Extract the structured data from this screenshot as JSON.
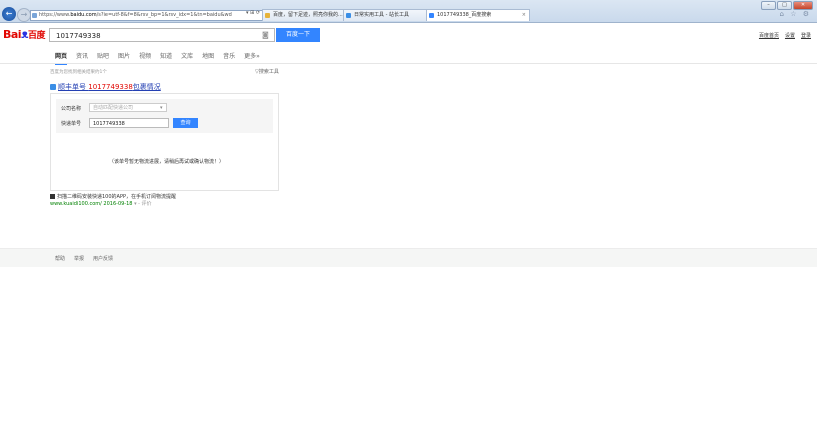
{
  "browser": {
    "address_prefix": "https://www.",
    "address_host": "baidu.com",
    "address_rest": "/s?ie=utf-8&f=8&rsv_bp=1&rsv_idx=1&tn=baidu&wd",
    "address_tools": "▾ ⊞ ⟳",
    "tabs": [
      {
        "label": "百度，留下足迹，照亮你我的...",
        "color": "#e6b33a",
        "active": false
      },
      {
        "label": "日常实用工具 - 站长工具",
        "color": "#3a8ee6",
        "active": false
      },
      {
        "label": "1017749338_百度搜索",
        "color": "#3385ff",
        "active": true
      }
    ],
    "right_icons": "⌂ ☆ ⚙"
  },
  "logo": {
    "text_left": "Bai",
    "paw": "ᴥ",
    "text_right": "百度"
  },
  "search": {
    "query": "1017749338",
    "button_label": "百度一下"
  },
  "top_links": [
    "百度首页",
    "设置",
    "登录"
  ],
  "nav_tabs": [
    "网页",
    "资讯",
    "贴吧",
    "图片",
    "视频",
    "知道",
    "文库",
    "地图",
    "音乐",
    "更多»"
  ],
  "result_count": "百度为您找到相关结果约1个",
  "search_tools": "▽搜索工具",
  "express_card": {
    "title_prefix": "顺丰单号 ",
    "title_number": "1017749338",
    "title_suffix": "包裹情况",
    "company_label": "公司名称",
    "company_placeholder": "自动匹配快递公司",
    "tracking_label": "快递单号",
    "tracking_value": "1017749338",
    "query_button": "查询",
    "notice": "（该单号暂无物流进展，请稍后再试或确认物流！）"
  },
  "kuaidi": {
    "promo": "扫描二维码安装快递100的APP，在手机订阅物流提醒",
    "url": "www.kuaidi100.com/ 2016-09-18",
    "extra": "▾ - 评价"
  },
  "footer_links": [
    "帮助",
    "举报",
    "用户反馈"
  ]
}
